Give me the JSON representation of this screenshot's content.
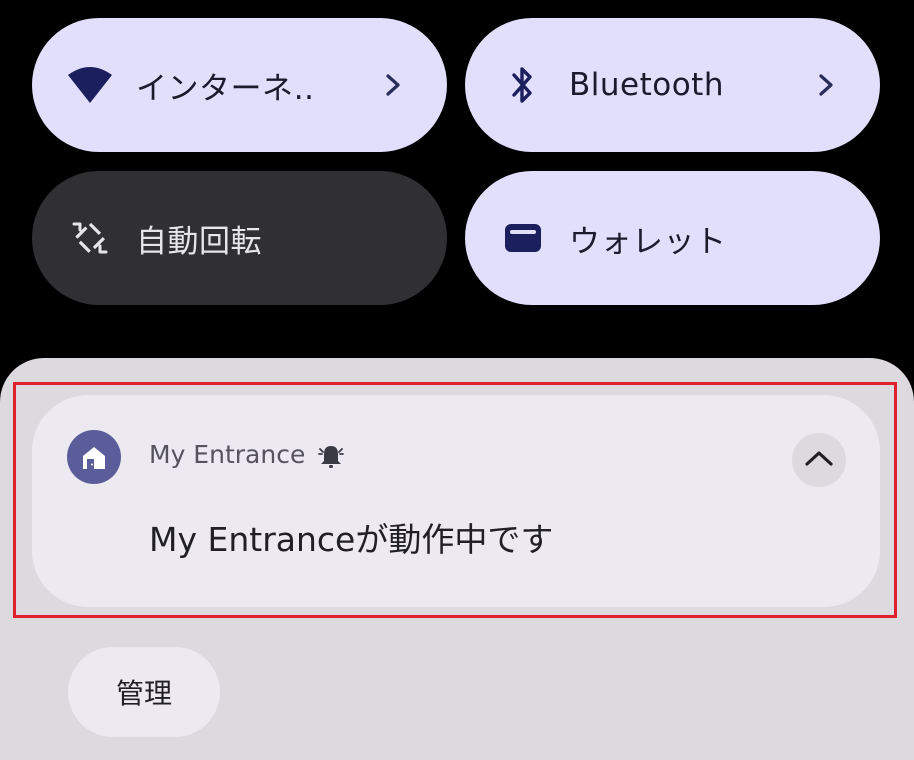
{
  "quick_settings": {
    "internet": {
      "label": "インターネ‥",
      "icon": "wifi-icon"
    },
    "bluetooth": {
      "label": "Bluetooth",
      "icon": "bluetooth-icon"
    },
    "auto_rotate": {
      "label": "自動回転",
      "icon": "rotate-icon"
    },
    "wallet": {
      "label": "ウォレット",
      "icon": "wallet-icon"
    }
  },
  "notification": {
    "app_name": "My Entrance",
    "app_icon": "home-icon",
    "alert_icon": "bell-icon",
    "message": "My Entranceが動作中です",
    "expand_icon": "chevron-up-icon"
  },
  "manage_button": {
    "label": "管理"
  },
  "colors": {
    "tile_active": "#e1dffb",
    "tile_inactive": "#303033",
    "shade": "#dcdadf",
    "notification_card": "#eceaf0",
    "app_icon_bg": "#5a5d9a",
    "highlight_border": "#e0202a"
  }
}
